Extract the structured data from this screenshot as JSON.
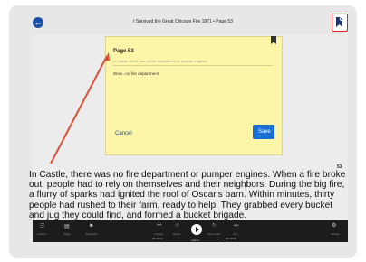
{
  "book_title": "I Survived the Great Chicago Fire 1871 • Page 53",
  "note_panel": {
    "page_label": "Page 53",
    "quote": "In Castle, there was no fire department or pumper engines.",
    "note_text": "Wow...no fire department!",
    "cancel_label": "Cancel",
    "save_label": "Save"
  },
  "page": {
    "number": "53",
    "text": "In Castle, there was no fire department or pumper engines. When a fire broke out, people had to rely on themselves and their neighbors. During the big fire, a flurry of sparks had ignited the roof of Oscar's barn. Within minutes, thirty people had rushed to their farm, ready to help. They grabbed every bucket and jug they could find, and formed a bucket brigade."
  },
  "controls": {
    "contents_label": "Contents",
    "pages_label": "Pages",
    "bookmarks_label": "Bookmarks",
    "previous_label": "Previous",
    "rewind_label": "Rewind",
    "fast_forward_label": "Fast forward",
    "next_label": "Next",
    "settings_label": "Settings",
    "elapsed": "00:46:12",
    "remaining": "-00:03:36",
    "page_indicator": "Page 53",
    "progress": 0.93
  },
  "colors": {
    "accent": "#1a4fa3",
    "highlight_border": "#d9232a",
    "note_bg": "#fdf6a8",
    "save_button": "#1a6fd6",
    "arrow": "#d9533a"
  }
}
